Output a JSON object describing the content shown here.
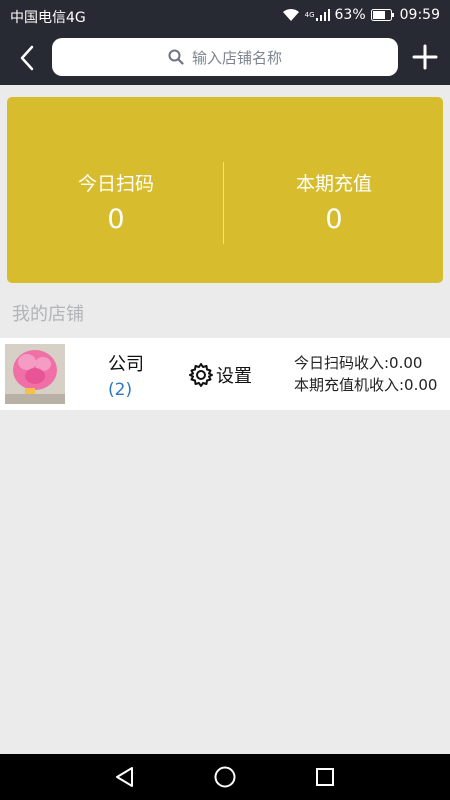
{
  "status_bar": {
    "carrier": "中国电信4G",
    "network_badge": "4G",
    "battery": "63%",
    "time": "09:59"
  },
  "topbar": {
    "search_placeholder": "输入店铺名称"
  },
  "summary": {
    "today_scan_label": "今日扫码",
    "today_scan_value": "0",
    "period_recharge_label": "本期充值",
    "period_recharge_value": "0"
  },
  "section": {
    "my_stores_title": "我的店铺"
  },
  "stores": [
    {
      "name": "公司",
      "count": "(2)",
      "settings_label": "设置",
      "today_income": "今日扫码收入:0.00",
      "period_income": "本期充值机收入:0.00"
    }
  ],
  "colors": {
    "header_bg": "#282a33",
    "summary_bg": "#d7bd2d",
    "count_link": "#2a78c0"
  }
}
